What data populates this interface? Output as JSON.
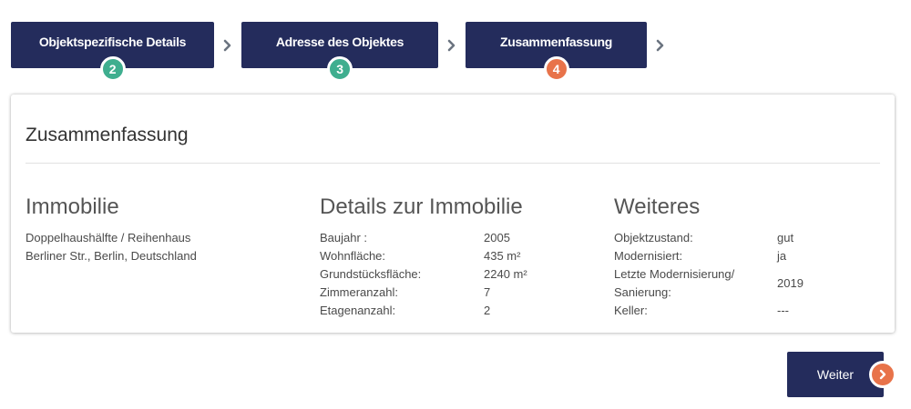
{
  "steps": [
    {
      "label": "Objektspezifische Details",
      "number": "2",
      "state": "done"
    },
    {
      "label": "Adresse des Objektes",
      "number": "3",
      "state": "done"
    },
    {
      "label": "Zusammenfassung",
      "number": "4",
      "state": "active"
    }
  ],
  "colors": {
    "navy": "#242c5c",
    "done": "#3fae8f",
    "active": "#e8734a"
  },
  "summary": {
    "title": "Zusammenfassung",
    "immobilie": {
      "heading": "Immobilie",
      "type": "Doppelhaushälfte / Reihenhaus",
      "address": "Berliner Str., Berlin, Deutschland"
    },
    "details": {
      "heading": "Details zur Immobilie",
      "rows": [
        {
          "label": "Baujahr :",
          "value": "2005"
        },
        {
          "label": "Wohnfläche:",
          "value": "435 m²"
        },
        {
          "label": "Grundstücksfläche:",
          "value": "2240 m²"
        },
        {
          "label": "Zimmeranzahl:",
          "value": "7"
        },
        {
          "label": "Etagenanzahl:",
          "value": "2"
        }
      ]
    },
    "weiteres": {
      "heading": "Weiteres",
      "rows": [
        {
          "label": "Objektzustand:",
          "value": "gut"
        },
        {
          "label": "Modernisiert:",
          "value": "ja"
        },
        {
          "label": "Letzte Modernisierung/ Sanierung:",
          "value": "2019"
        },
        {
          "label": "Keller:",
          "value": "---"
        }
      ]
    }
  },
  "next_button": {
    "label": "Weiter",
    "icon": "chevron-right-icon"
  }
}
